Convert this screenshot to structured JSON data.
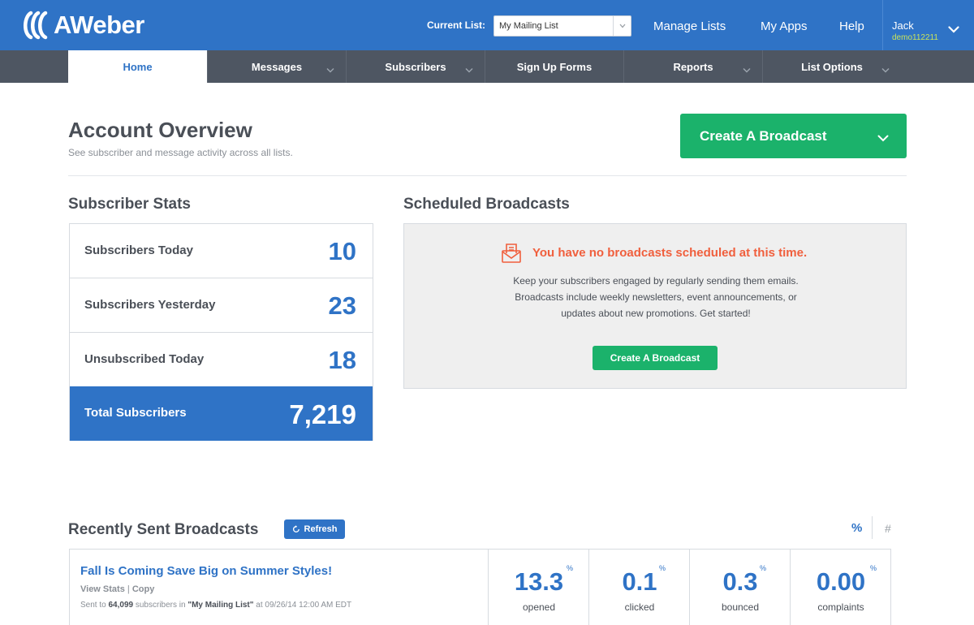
{
  "header": {
    "logo_text": "AWeber",
    "current_list_label": "Current List:",
    "current_list_value": "My Mailing List",
    "nav": [
      "Manage Lists",
      "My Apps",
      "Help"
    ],
    "user": {
      "name": "Jack",
      "id": "demo112211"
    }
  },
  "subnav": {
    "items": [
      {
        "label": "Home",
        "active": true,
        "dropdown": false
      },
      {
        "label": "Messages",
        "active": false,
        "dropdown": true
      },
      {
        "label": "Subscribers",
        "active": false,
        "dropdown": true
      },
      {
        "label": "Sign Up Forms",
        "active": false,
        "dropdown": false
      },
      {
        "label": "Reports",
        "active": false,
        "dropdown": true
      },
      {
        "label": "List Options",
        "active": false,
        "dropdown": true
      }
    ]
  },
  "overview": {
    "title": "Account Overview",
    "subtitle": "See subscriber and message activity across all lists.",
    "cta_label": "Create A Broadcast"
  },
  "subscriber_stats": {
    "heading": "Subscriber Stats",
    "rows": [
      {
        "label": "Subscribers Today",
        "value": "10"
      },
      {
        "label": "Subscribers Yesterday",
        "value": "23"
      },
      {
        "label": "Unsubscribed Today",
        "value": "18"
      },
      {
        "label": "Total Subscribers",
        "value": "7,219"
      }
    ]
  },
  "scheduled": {
    "heading": "Scheduled Broadcasts",
    "headline": "You have no broadcasts scheduled at this time.",
    "body_lines": [
      "Keep your subscribers engaged by regularly sending them emails.",
      "Broadcasts include weekly newsletters, event announcements, or",
      "updates about new promotions. Get started!"
    ],
    "button_label": "Create A Broadcast"
  },
  "recent": {
    "heading": "Recently Sent Broadcasts",
    "refresh_label": "Refresh",
    "toggle_percent": "%",
    "toggle_number": "#",
    "broadcast": {
      "title": "Fall Is Coming Save Big on Summer Styles!",
      "view_stats": "View Stats",
      "copy": "Copy",
      "sent_prefix": "Sent to",
      "sent_count": "64,099",
      "sent_middle": "subscribers in",
      "sent_list": "\"My Mailing List\"",
      "sent_suffix": "at 09/26/14 12:00 AM EDT",
      "metrics": [
        {
          "value": "13.3",
          "label": "opened"
        },
        {
          "value": "0.1",
          "label": "clicked"
        },
        {
          "value": "0.3",
          "label": "bounced"
        },
        {
          "value": "0.00",
          "label": "complaints"
        }
      ],
      "metric_unit": "%"
    }
  },
  "colors": {
    "brand_blue": "#2f73c6",
    "subnav_gray": "#4e5662",
    "cta_green": "#1bb26b",
    "alert_orange": "#f05f3d"
  }
}
